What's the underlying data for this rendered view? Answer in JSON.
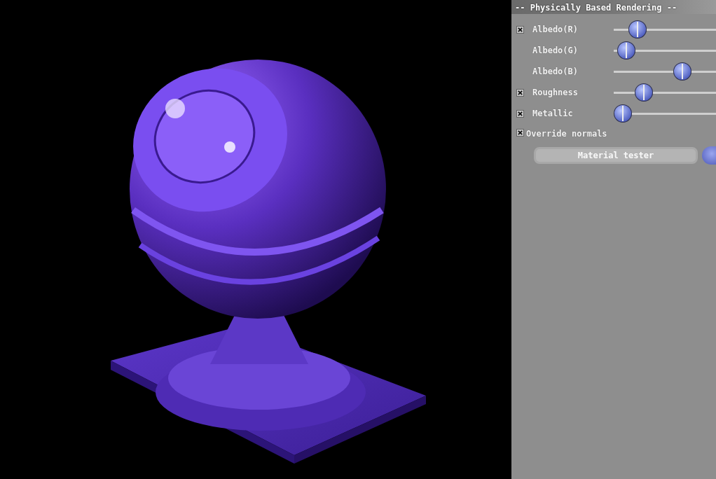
{
  "panel": {
    "title": "-- Physically Based Rendering --",
    "controls": [
      {
        "kind": "slider",
        "label": "Albedo(R)",
        "checked": true,
        "level": 0.17
      },
      {
        "kind": "slider",
        "label": "Albedo(G)",
        "level": 0.04
      },
      {
        "kind": "slider",
        "label": "Albedo(B)",
        "level": 0.71
      },
      {
        "kind": "slider",
        "label": "Roughness",
        "checked": true,
        "level": 0.25
      },
      {
        "kind": "slider",
        "label": "Metallic",
        "checked": true,
        "level": 0.0
      },
      {
        "kind": "checkbox",
        "label": "Override normals",
        "checked": true
      }
    ],
    "dropdown": {
      "value": "Material tester"
    }
  }
}
